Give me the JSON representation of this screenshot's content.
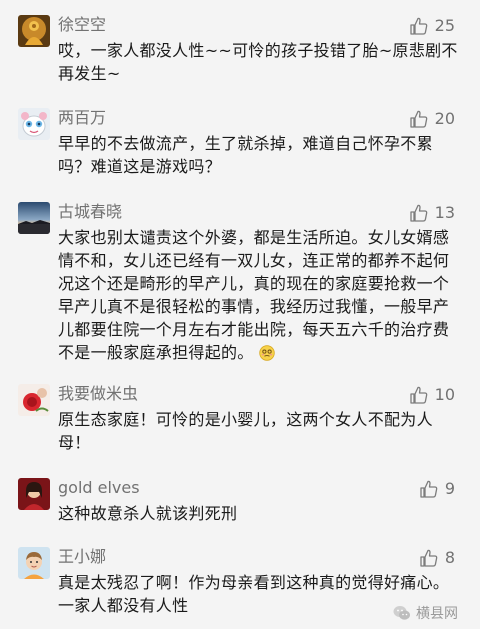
{
  "comments": [
    {
      "name": "徐空空",
      "likes": "25",
      "text": "哎，一家人都没人性~~可怜的孩子投错了胎~原悲剧不再发生~",
      "avatar": "buddha-avatar"
    },
    {
      "name": "两百万",
      "likes": "20",
      "text": "早早的不去做流产，生了就杀掉，难道自己怀孕不累吗？难道这是游戏吗？",
      "avatar": "cartoon-avatar"
    },
    {
      "name": "古城春晓",
      "likes": "13",
      "text": "大家也别太谴责这个外婆，都是生活所迫。女儿女婿感情不和，女儿还已经有一双儿女，连正常的都养不起何况这个还是畸形的早产儿，真的现在的家庭要抢救一个早产儿真不是很轻松的事情，我经历过我懂，一般早产儿都要住院一个月左右才能出院，每天五六千的治疗费不是一般家庭承担得起的。",
      "avatar": "sunset-avatar",
      "has_emoji": true
    },
    {
      "name": "我要做米虫",
      "likes": "10",
      "text": "原生态家庭！可怜的是小婴儿，这两个女人不配为人母！",
      "avatar": "flower-avatar"
    },
    {
      "name": "gold elves",
      "likes": "9",
      "text": "这种故意杀人就该判死刑",
      "avatar": "girl-avatar"
    },
    {
      "name": "王小娜",
      "likes": "8",
      "text": "真是太残忍了啊！作为母亲看到这种真的觉得好痛心。一家人都没有人性",
      "avatar": "child-avatar"
    }
  ],
  "watermark": "横县网",
  "icons": {
    "like": "thumbs-up-icon",
    "emoji": "embarrassed-emoji",
    "watermark": "wechat-icon"
  }
}
